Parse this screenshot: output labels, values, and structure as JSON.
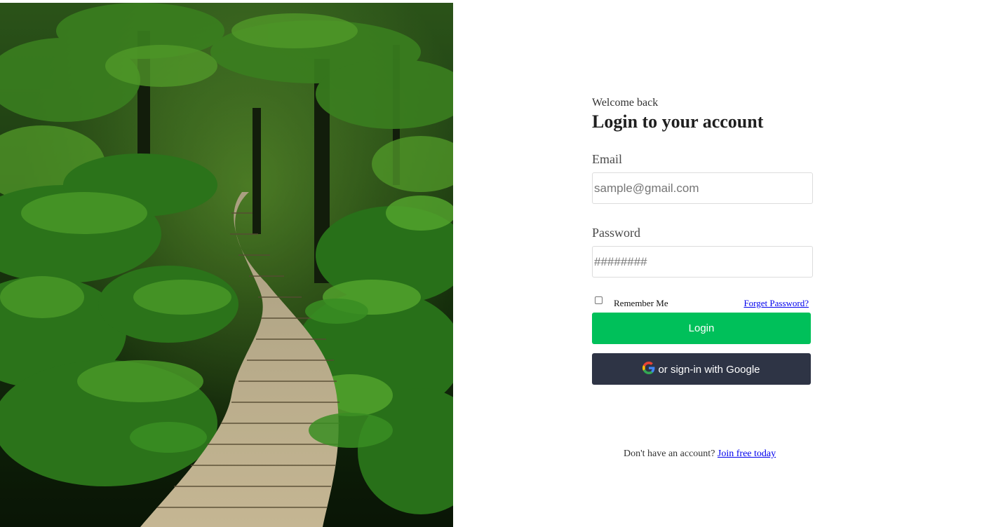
{
  "hero": {
    "description_icon": "jungle-boardwalk-image"
  },
  "login": {
    "welcome": "Welcome back",
    "title": "Login to your account",
    "email_label": "Email",
    "email_placeholder": "sample@gmail.com",
    "password_label": "Password",
    "password_placeholder": "########",
    "remember_label": "Remember Me",
    "remember_checked": false,
    "forgot_link": "Forget Password?",
    "login_button": "Login",
    "google_button": "or sign-in with Google",
    "google_icon": "google-icon"
  },
  "signup": {
    "prompt": "Don't have an account?",
    "link": "Join free today"
  },
  "colors": {
    "login_button": "#00c05a",
    "google_button": "#2e3445",
    "link": "#0000ee"
  }
}
